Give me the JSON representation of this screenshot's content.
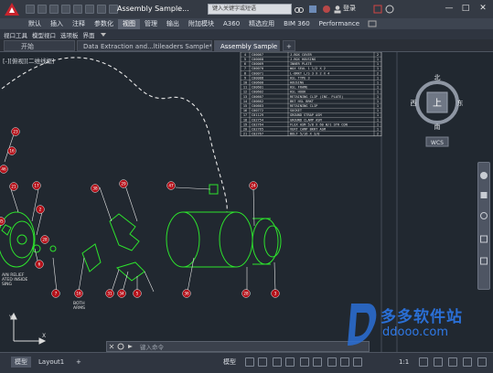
{
  "window": {
    "doc_title": "Assembly Sample...",
    "search_placeholder": "键入关键字或短语",
    "login": "登录",
    "minimize": "—",
    "maximize": "□",
    "close": "✕"
  },
  "ribbon": {
    "tabs": [
      "默认",
      "插入",
      "注释",
      "参数化",
      "视图",
      "管理",
      "输出",
      "附加模块",
      "A360",
      "精选应用",
      "BIM 360",
      "Performance"
    ],
    "active": "视图"
  },
  "panels": [
    "视口工具",
    "模型视口",
    "选项板",
    "界面"
  ],
  "file_tabs": {
    "start": "开始",
    "tab1": "Data Extraction and...ltileaders Sample*",
    "tab2": "Assembly Sample",
    "add": "+"
  },
  "viewport_label": "[-][俯视][二维线框]",
  "viewcube": {
    "north": "北",
    "south": "南",
    "east": "东",
    "west": "西",
    "top": "上",
    "wcs": "WCS"
  },
  "bom_table": {
    "rows": [
      [
        "4",
        "C00067",
        "J-BOX COVER",
        "2"
      ],
      [
        "5",
        "C00068",
        "J-BOX HOUSING",
        "1"
      ],
      [
        "6",
        "C00069",
        "INNER PLATE",
        "1"
      ],
      [
        "7",
        "C00070",
        "WAX SEAL 1 1/2 X 2",
        "1"
      ],
      [
        "8",
        "C00071",
        "L-BRKT L/S 3 X 2 X 4",
        "2"
      ],
      [
        "9",
        "C00088",
        "HSL TYPE 3",
        "1"
      ],
      [
        "10",
        "C00600",
        "HOUSING",
        "1"
      ],
      [
        "11",
        "C00601",
        "HSL FRAME",
        "1"
      ],
      [
        "12",
        "C00602",
        "HSL HOOK",
        "1"
      ],
      [
        "13",
        "C00607",
        "RETAINING CLIP (INC. PLATE)",
        "1"
      ],
      [
        "14",
        "C00662",
        "BKT HSL BRKT",
        "1"
      ],
      [
        "15",
        "C00663",
        "RETAINING CLIP",
        "1"
      ],
      [
        "16",
        "C00772",
        "SOCKET",
        "1"
      ],
      [
        "17",
        "C01129",
        "GROUND STRAP ASM",
        "1"
      ],
      [
        "18",
        "C02754",
        "GROUND CLAMP ASM",
        "1"
      ],
      [
        "19",
        "C02764",
        "FLEX ASM 5/8 X 60 W/1 STR CON",
        "1"
      ],
      [
        "20",
        "C02765",
        "VERT CAMP BKRT ASM",
        "1"
      ],
      [
        "21",
        "C02767",
        "BOLT 5/16 X 3/8",
        "2"
      ]
    ]
  },
  "balloons": [
    "23",
    "16",
    "46",
    "17",
    "2",
    "28",
    "21",
    "38",
    "29",
    "47",
    "24",
    "6",
    "7",
    "16",
    "31",
    "34",
    "5",
    "36",
    "28",
    "3",
    "45"
  ],
  "notes": {
    "left": "AIN RELIEF\nATED INSIDE\nSING",
    "mid": "BOTH\nARMS"
  },
  "command": {
    "close": "✕",
    "settings": "🔧",
    "placeholder": "键入命令"
  },
  "status": {
    "model_tab": "模型",
    "layout_tab": "Layout1",
    "add_tab": "+",
    "model_btn": "模型",
    "scale": "1:1"
  },
  "watermark": {
    "name": "多多软件站",
    "url": "ddooo.com"
  },
  "colors": {
    "title_bg": "#343a44",
    "ribbon_bg": "#3d4450",
    "canvas_bg": "#212830",
    "drawing_green": "#2de32d",
    "balloon_red": "#b4111a",
    "watermark_blue": "#2a6fd6"
  }
}
